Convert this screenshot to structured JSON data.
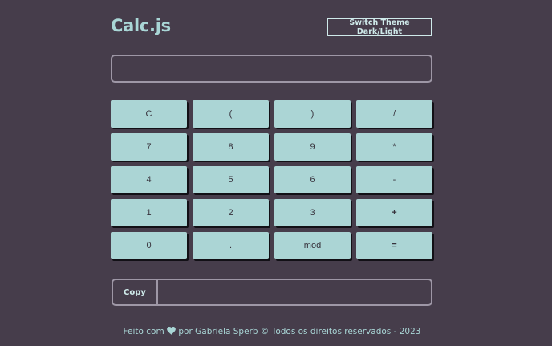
{
  "header": {
    "title": "Calc.js",
    "theme_button_label": "Switch Theme Dark/Light"
  },
  "display": {
    "value": "",
    "placeholder": ""
  },
  "keypad": {
    "keys": [
      {
        "label": "C"
      },
      {
        "label": "("
      },
      {
        "label": ")"
      },
      {
        "label": "/"
      },
      {
        "label": "7"
      },
      {
        "label": "8"
      },
      {
        "label": "9"
      },
      {
        "label": "*"
      },
      {
        "label": "4"
      },
      {
        "label": "5"
      },
      {
        "label": "6"
      },
      {
        "label": "-"
      },
      {
        "label": "1"
      },
      {
        "label": "2"
      },
      {
        "label": "3"
      },
      {
        "label": "+"
      },
      {
        "label": "0"
      },
      {
        "label": "."
      },
      {
        "label": "mod"
      },
      {
        "label": "="
      }
    ]
  },
  "copy": {
    "button_label": "Copy",
    "value": ""
  },
  "footer": {
    "prefix": "Feito com",
    "heart_icon": "heart-icon",
    "suffix": "por Gabriela Sperb © Todos os direitos reservados - 2023"
  },
  "colors": {
    "background": "#463d4b",
    "accent": "#a9d6d6",
    "key_background": "#abd5d5",
    "key_text": "#37323c"
  }
}
